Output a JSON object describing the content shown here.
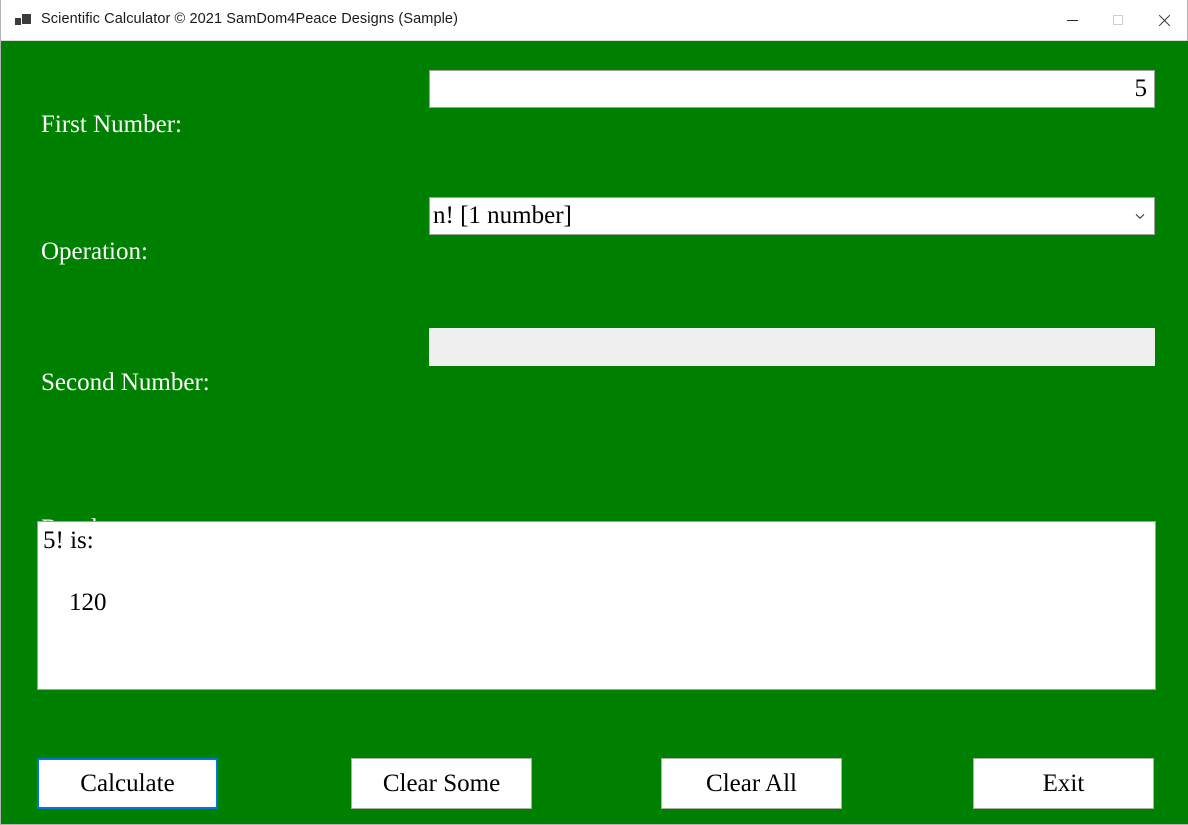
{
  "window": {
    "title": "Scientific Calculator © 2021 SamDom4Peace Designs (Sample)",
    "app_icon": "app-squares-icon",
    "background_color": "#008000",
    "controls": {
      "minimize": "minimize-icon",
      "maximize": "maximize-icon",
      "close": "close-icon"
    }
  },
  "form": {
    "first_number": {
      "label": "First Number:",
      "value": "5",
      "placeholder": ""
    },
    "operation": {
      "label": "Operation:",
      "selected": "n! [1 number]",
      "chevron": "chevron-down-icon"
    },
    "second_number": {
      "label": "Second Number:",
      "value": "",
      "placeholder": "",
      "disabled": true
    },
    "result": {
      "label": "Result:",
      "line1": "5! is:",
      "line2": "",
      "line3": "120"
    }
  },
  "buttons": {
    "calculate": "Calculate",
    "clear_some": "Clear Some",
    "clear_all": "Clear All",
    "exit": "Exit",
    "focus_color": "#0078d7"
  }
}
